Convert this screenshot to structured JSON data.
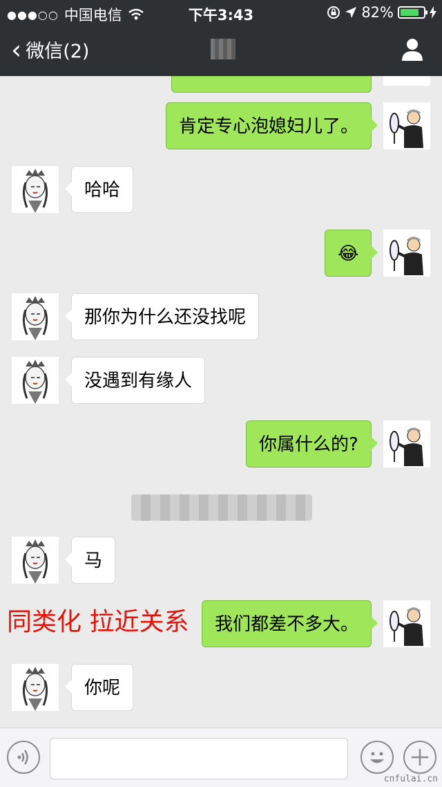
{
  "status": {
    "carrier": "中国电信",
    "time": "下午3:43",
    "battery_text": "82%",
    "battery_level": 0.82
  },
  "nav": {
    "back_label": "微信(2)"
  },
  "messages": [
    {
      "dir": "out",
      "text": "肯定专心泡媳妇儿了。"
    },
    {
      "dir": "in",
      "text": "哈哈"
    },
    {
      "dir": "out",
      "emoji": "😂"
    },
    {
      "dir": "in",
      "text": "那你为什么还没找呢"
    },
    {
      "dir": "in",
      "text": "没遇到有缘人"
    },
    {
      "dir": "out",
      "text": "你属什么的?"
    },
    {
      "dir": "in",
      "text": "马"
    },
    {
      "dir": "out",
      "text": "我们都差不多大。"
    },
    {
      "dir": "in",
      "text": "你呢"
    }
  ],
  "annotation": "同类化  拉近关系",
  "watermark": "cnfulai.cn",
  "colors": {
    "nav_bg": "#2e3134",
    "out_bubble": "#9fe65b",
    "in_bubble": "#ffffff",
    "chat_bg": "#ebebeb",
    "annotation": "#e0140b"
  },
  "icons": {
    "voice": "voice-icon",
    "emoji": "emoji-icon",
    "plus": "plus-icon",
    "profile": "person-icon",
    "back": "chevron-left-icon"
  }
}
